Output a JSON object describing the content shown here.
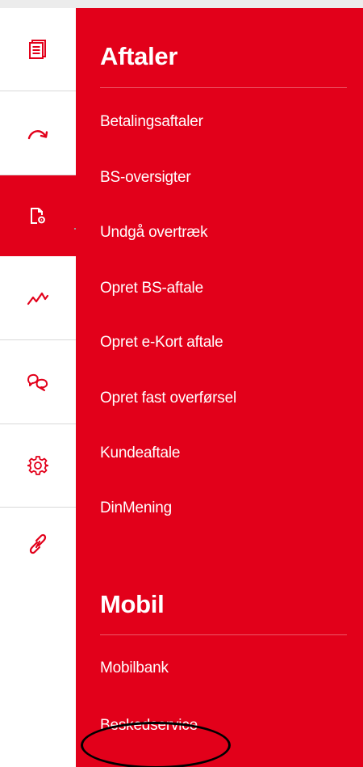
{
  "rail": {
    "items": [
      {
        "icon": "documents-icon",
        "active": false
      },
      {
        "icon": "transfer-arrow-icon",
        "active": false
      },
      {
        "icon": "agreement-settings-icon",
        "active": true
      },
      {
        "icon": "investment-graph-icon",
        "active": false
      },
      {
        "icon": "chat-icon",
        "active": false
      },
      {
        "icon": "gear-icon",
        "active": false
      },
      {
        "icon": "link-icon",
        "active": false
      }
    ]
  },
  "menu": {
    "aftaler": {
      "title": "Aftaler",
      "items": [
        {
          "label": "Betalingsaftaler"
        },
        {
          "label": "BS-oversigter"
        },
        {
          "label": "Undgå overtræk"
        },
        {
          "label": "Opret BS-aftale"
        },
        {
          "label": "Opret e-Kort aftale"
        },
        {
          "label": "Opret fast overførsel"
        },
        {
          "label": "Kundeaftale"
        },
        {
          "label": "DinMening"
        }
      ]
    },
    "mobil": {
      "title": "Mobil",
      "items": [
        {
          "label": "Mobilbank"
        },
        {
          "label": "Beskedservice"
        }
      ]
    }
  },
  "colors": {
    "brand_red": "#e2001a",
    "icon_red": "#e2001a",
    "text_on_red": "#ffffff",
    "annotation_ring": "#000000"
  }
}
